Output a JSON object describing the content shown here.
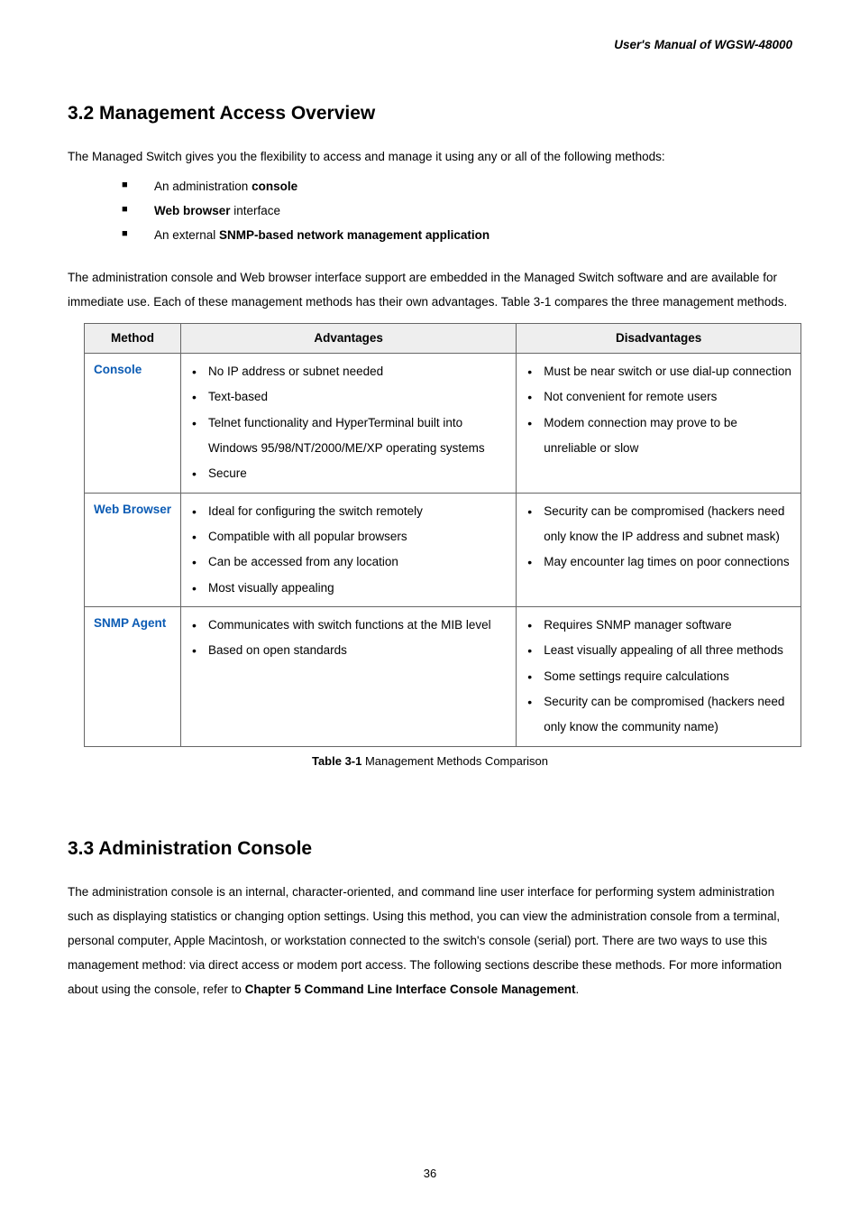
{
  "header": {
    "manual_title": "User's Manual of WGSW-48000"
  },
  "section_32": {
    "heading": "3.2 Management Access Overview",
    "intro": "The Managed Switch gives you the flexibility to access and manage it using any or all of the following methods:",
    "methods": [
      {
        "prefix": "An administration ",
        "bold": "console",
        "suffix": ""
      },
      {
        "prefix": "",
        "bold": "Web browser",
        "suffix": " interface"
      },
      {
        "prefix": "An external ",
        "bold": "SNMP-based network management application",
        "suffix": ""
      }
    ],
    "para2": "The administration console and Web browser interface support are embedded in the Managed Switch software and are available for immediate use. Each of these management methods has their own advantages. Table 3-1 compares the three management methods."
  },
  "table": {
    "headers": {
      "method": "Method",
      "advantages": "Advantages",
      "disadvantages": "Disadvantages"
    },
    "rows": [
      {
        "method": "Console",
        "advantages": [
          "No IP address or subnet needed",
          "Text-based",
          "Telnet functionality and HyperTerminal built into Windows 95/98/NT/2000/ME/XP operating systems",
          "Secure"
        ],
        "disadvantages": [
          "Must be near switch or use dial-up connection",
          "Not convenient for remote users",
          "Modem connection may prove to be unreliable or slow"
        ]
      },
      {
        "method": "Web Browser",
        "advantages": [
          "Ideal for configuring the switch remotely",
          "Compatible with all popular browsers",
          "Can be accessed from any location",
          "Most visually appealing"
        ],
        "disadvantages": [
          "Security can be compromised (hackers need only know the IP address and subnet mask)",
          "May encounter lag times on poor connections"
        ]
      },
      {
        "method": "SNMP Agent",
        "advantages": [
          "Communicates with switch functions at the MIB level",
          "Based on open standards"
        ],
        "disadvantages": [
          "Requires SNMP manager software",
          "Least visually appealing of all three methods",
          "Some settings require calculations",
          "Security can be compromised (hackers need only know the community name)"
        ]
      }
    ],
    "caption_label": "Table 3-1",
    "caption_text": " Management Methods Comparison"
  },
  "section_33": {
    "heading": "3.3 Administration Console",
    "para_prefix": "The administration console is an internal, character-oriented, and command line user interface for performing system administration such as displaying statistics or changing option settings. Using this method, you can view the administration console from a terminal, personal computer, Apple Macintosh, or workstation connected to the switch's console (serial) port. There are two ways to use this management method: via direct access or modem port access. The following sections describe these methods. For more information about using the console, refer to ",
    "para_bold": "Chapter 5 Command Line Interface Console Management",
    "para_suffix": "."
  },
  "page_number": "36"
}
